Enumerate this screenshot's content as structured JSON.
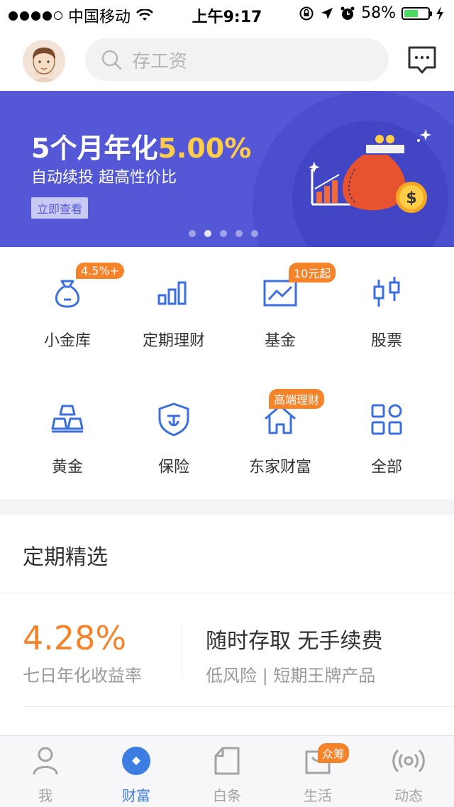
{
  "status_bar": {
    "carrier": "中国移动",
    "time": "上午9:17",
    "battery_percent": "58%",
    "battery_level": 0.58
  },
  "header": {
    "search_placeholder": "存工资"
  },
  "banner": {
    "title_prefix": "5个月年化",
    "title_highlight": "5.00%",
    "subtitle": "自动续投 超高性价比",
    "cta_label": "立即查看",
    "slide_count": 5,
    "active_slide": 2,
    "accent_color": "#ffcd48"
  },
  "grid": {
    "items": [
      {
        "label": "小金库",
        "badge": "4.5%+",
        "icon": "money-bag-icon"
      },
      {
        "label": "定期理财",
        "badge": "",
        "icon": "bar-chart-icon"
      },
      {
        "label": "基金",
        "badge": "10元起",
        "icon": "line-chart-icon"
      },
      {
        "label": "股票",
        "badge": "",
        "icon": "candlestick-icon"
      },
      {
        "label": "黄金",
        "badge": "",
        "icon": "gold-bars-icon"
      },
      {
        "label": "保险",
        "badge": "",
        "icon": "shield-icon"
      },
      {
        "label": "东家财富",
        "badge": "高端理财",
        "icon": "house-icon"
      },
      {
        "label": "全部",
        "badge": "",
        "icon": "grid-icon"
      }
    ]
  },
  "section": {
    "title": "定期精选",
    "rate": "4.28%",
    "rate_label": "七日年化收益率",
    "product_title": "随时存取 无手续费",
    "product_sub": "低风险 | 短期王牌产品"
  },
  "tabbar": {
    "tabs": [
      {
        "label": "我",
        "icon": "person-icon"
      },
      {
        "label": "财富",
        "icon": "wealth-icon"
      },
      {
        "label": "白条",
        "icon": "note-icon"
      },
      {
        "label": "生活",
        "icon": "bag-icon",
        "badge": "众筹"
      },
      {
        "label": "动态",
        "icon": "broadcast-icon"
      }
    ],
    "active_color": "#3b7de0"
  }
}
